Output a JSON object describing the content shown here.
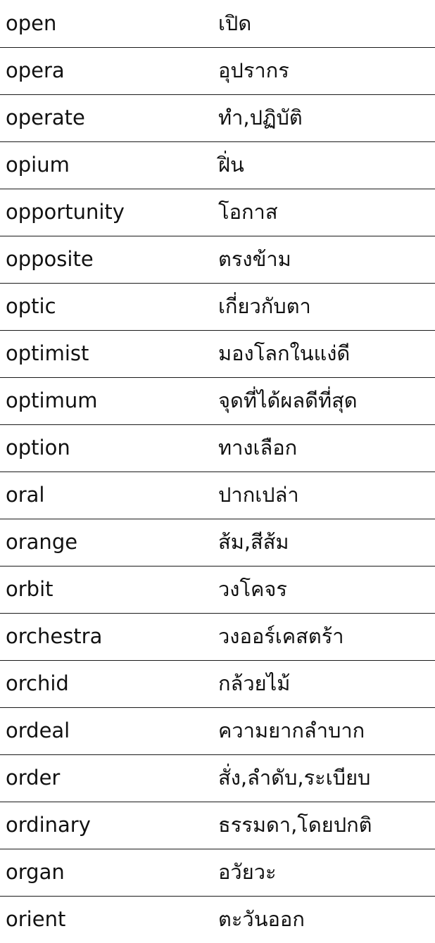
{
  "entries": [
    {
      "english": "open",
      "thai": "เปิด"
    },
    {
      "english": "opera",
      "thai": "อุปรากร"
    },
    {
      "english": "operate",
      "thai": "ทำ,ปฏิบัติ"
    },
    {
      "english": "opium",
      "thai": "ฝิ่น"
    },
    {
      "english": "opportunity",
      "thai": "โอกาส"
    },
    {
      "english": "opposite",
      "thai": "ตรงข้าม"
    },
    {
      "english": "optic",
      "thai": "เกี่ยวกับตา"
    },
    {
      "english": "optimist",
      "thai": "มองโลกในแง่ดี"
    },
    {
      "english": "optimum",
      "thai": "จุดที่ได้ผลดีที่สุด"
    },
    {
      "english": "option",
      "thai": "ทางเลือก"
    },
    {
      "english": "oral",
      "thai": "ปากเปล่า"
    },
    {
      "english": "orange",
      "thai": "ส้ม,สีส้ม"
    },
    {
      "english": "orbit",
      "thai": "วงโคจร"
    },
    {
      "english": "orchestra",
      "thai": "วงออร์เคสตร้า"
    },
    {
      "english": "orchid",
      "thai": "กล้วยไม้"
    },
    {
      "english": "ordeal",
      "thai": "ความยากลำบาก"
    },
    {
      "english": "order",
      "thai": "สั่ง,ลำดับ,ระเบียบ"
    },
    {
      "english": "ordinary",
      "thai": "ธรรมดา,โดยปกติ"
    },
    {
      "english": "organ",
      "thai": "อวัยวะ"
    },
    {
      "english": "orient",
      "thai": "ตะวันออก"
    }
  ]
}
